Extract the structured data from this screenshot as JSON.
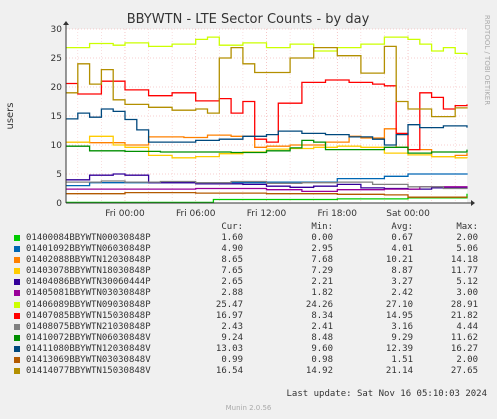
{
  "chart_data": {
    "type": "line",
    "title": "BBYWTN - LTE Sector Counts - by day",
    "ylabel": "users",
    "ylim": [
      0,
      30
    ],
    "y_ticks": [
      0,
      5,
      10,
      15,
      20,
      25,
      30
    ],
    "x_ticks": [
      "Fri 00:00",
      "Fri 06:00",
      "Fri 12:00",
      "Fri 18:00",
      "Sat 00:00"
    ],
    "x_range_hours": [
      -5,
      29
    ],
    "grid": true,
    "side_label": "RRDTOOL / TOBI OETIKER",
    "series": [
      {
        "name": "01400084BBYWTN00030848P",
        "color": "#00cc00",
        "cur": "1.60",
        "min": "0.00",
        "avg": "0.67",
        "max": "2.00",
        "points": [
          [
            -5,
            0.1
          ],
          [
            7,
            0.1
          ],
          [
            7.5,
            0.6
          ],
          [
            12,
            0.6
          ],
          [
            18,
            0.7
          ],
          [
            24,
            0.9
          ],
          [
            29,
            1.6
          ]
        ]
      },
      {
        "name": "01401092BBYWTN06030848P",
        "color": "#0066b3",
        "cur": "4.90",
        "min": "2.95",
        "avg": "4.01",
        "max": "5.06",
        "points": [
          [
            -5,
            3.0
          ],
          [
            -3,
            3.5
          ],
          [
            0,
            3.5
          ],
          [
            6,
            3.5
          ],
          [
            12,
            3.6
          ],
          [
            18,
            4.2
          ],
          [
            22,
            4.6
          ],
          [
            24,
            5.0
          ],
          [
            29,
            4.9
          ]
        ]
      },
      {
        "name": "01402088BBYWTN12030848P",
        "color": "#ff8000",
        "cur": "8.65",
        "min": "7.68",
        "avg": "10.21",
        "max": "14.18",
        "points": [
          [
            -5,
            10.5
          ],
          [
            -3,
            10.4
          ],
          [
            0,
            10
          ],
          [
            2,
            11.4
          ],
          [
            5,
            11.3
          ],
          [
            7,
            11.7
          ],
          [
            9,
            11.5
          ],
          [
            11,
            9.6
          ],
          [
            12,
            9.8
          ],
          [
            14,
            10
          ],
          [
            17,
            10.5
          ],
          [
            19,
            11.5
          ],
          [
            20,
            11.2
          ],
          [
            22,
            12.8
          ],
          [
            23,
            9.6
          ],
          [
            24,
            9.2
          ],
          [
            26,
            8
          ],
          [
            28,
            8.2
          ],
          [
            29,
            8.6
          ]
        ]
      },
      {
        "name": "01403078BBYWTN18030848P",
        "color": "#ffcc00",
        "cur": "7.65",
        "min": "7.29",
        "avg": "8.87",
        "max": "11.77",
        "points": [
          [
            -5,
            10.5
          ],
          [
            -3,
            11.5
          ],
          [
            -1,
            10
          ],
          [
            0,
            9.6
          ],
          [
            2,
            8.2
          ],
          [
            4,
            7.8
          ],
          [
            6,
            8
          ],
          [
            8,
            8.5
          ],
          [
            10,
            8.8
          ],
          [
            12,
            9.3
          ],
          [
            14,
            9.4
          ],
          [
            16,
            9.6
          ],
          [
            18,
            9.8
          ],
          [
            20,
            9.6
          ],
          [
            22,
            8.6
          ],
          [
            24,
            8.3
          ],
          [
            26,
            8.0
          ],
          [
            28,
            7.8
          ],
          [
            29,
            7.7
          ]
        ]
      },
      {
        "name": "01404086BBYWTN30060444P",
        "color": "#330099",
        "cur": "2.65",
        "min": "2.21",
        "avg": "3.27",
        "max": "5.12",
        "points": [
          [
            -5,
            4.0
          ],
          [
            -3,
            4.8
          ],
          [
            -1,
            5.0
          ],
          [
            0,
            4.8
          ],
          [
            2,
            3.5
          ],
          [
            6,
            3.3
          ],
          [
            10,
            3.2
          ],
          [
            12,
            2.9
          ],
          [
            14,
            2.7
          ],
          [
            16,
            2.9
          ],
          [
            18,
            3.2
          ],
          [
            20,
            2.6
          ],
          [
            22,
            2.5
          ],
          [
            24,
            2.4
          ],
          [
            26,
            2.6
          ],
          [
            29,
            2.65
          ]
        ]
      },
      {
        "name": "01405081BBYWTN03030848P",
        "color": "#990099",
        "cur": "2.88",
        "min": "1.82",
        "avg": "2.42",
        "max": "3.00",
        "points": [
          [
            -5,
            2.4
          ],
          [
            0,
            2.4
          ],
          [
            6,
            2.5
          ],
          [
            12,
            2.3
          ],
          [
            15,
            2.0
          ],
          [
            18,
            2.3
          ],
          [
            22,
            2.4
          ],
          [
            25,
            2.8
          ],
          [
            29,
            2.88
          ]
        ]
      },
      {
        "name": "01406089BBYWTN09030848P",
        "color": "#ccff00",
        "cur": "25.47",
        "min": "24.26",
        "avg": "27.10",
        "max": "28.91",
        "points": [
          [
            -5,
            26.8
          ],
          [
            -3,
            27.5
          ],
          [
            -1,
            27.2
          ],
          [
            0,
            27.6
          ],
          [
            2,
            27.0
          ],
          [
            4,
            27.4
          ],
          [
            6,
            28.2
          ],
          [
            7,
            28.6
          ],
          [
            8,
            27.2
          ],
          [
            10,
            27.6
          ],
          [
            12,
            26.8
          ],
          [
            14,
            27.4
          ],
          [
            16,
            26.2
          ],
          [
            18,
            26.8
          ],
          [
            20,
            27.4
          ],
          [
            22,
            28.6
          ],
          [
            24,
            28.2
          ],
          [
            25,
            27.4
          ],
          [
            26,
            26.2
          ],
          [
            27,
            26.8
          ],
          [
            28,
            25.8
          ],
          [
            29,
            25.5
          ]
        ]
      },
      {
        "name": "01407085BBYWTN15030848P",
        "color": "#ff0000",
        "cur": "16.97",
        "min": "8.34",
        "avg": "14.95",
        "max": "21.82",
        "points": [
          [
            -5,
            20.6
          ],
          [
            -4,
            18.8
          ],
          [
            -2,
            21.0
          ],
          [
            0,
            19.5
          ],
          [
            2,
            18.5
          ],
          [
            4,
            19.0
          ],
          [
            6,
            17.6
          ],
          [
            8,
            18.0
          ],
          [
            9,
            15.5
          ],
          [
            10,
            17.5
          ],
          [
            11,
            11
          ],
          [
            12,
            10.5
          ],
          [
            13,
            17.2
          ],
          [
            15,
            20.8
          ],
          [
            17,
            21.2
          ],
          [
            19,
            20.8
          ],
          [
            21,
            20.5
          ],
          [
            22,
            20.2
          ],
          [
            23,
            12
          ],
          [
            24,
            9.2
          ],
          [
            25,
            19.0
          ],
          [
            26,
            18.2
          ],
          [
            27,
            16.2
          ],
          [
            28,
            16.8
          ],
          [
            29,
            17.0
          ]
        ]
      },
      {
        "name": "01408075BBYWTN21030848P",
        "color": "#808080",
        "cur": "2.43",
        "min": "2.41",
        "avg": "3.16",
        "max": "4.44",
        "points": [
          [
            -5,
            3.6
          ],
          [
            -2,
            3.8
          ],
          [
            0,
            3.6
          ],
          [
            3,
            3.7
          ],
          [
            6,
            3.5
          ],
          [
            9,
            3.7
          ],
          [
            12,
            3.4
          ],
          [
            15,
            3.5
          ],
          [
            18,
            3.6
          ],
          [
            21,
            3.2
          ],
          [
            24,
            2.8
          ],
          [
            27,
            2.5
          ],
          [
            29,
            2.43
          ]
        ]
      },
      {
        "name": "01410072BBYWTN06030848V",
        "color": "#008f00",
        "cur": "9.24",
        "min": "8.48",
        "avg": "9.29",
        "max": "11.62",
        "points": [
          [
            -5,
            9.8
          ],
          [
            -3,
            9.0
          ],
          [
            0,
            8.9
          ],
          [
            3,
            8.8
          ],
          [
            6,
            8.8
          ],
          [
            9,
            8.7
          ],
          [
            12,
            9.0
          ],
          [
            14,
            9.5
          ],
          [
            15,
            10.8
          ],
          [
            16,
            10.5
          ],
          [
            17,
            9.2
          ],
          [
            20,
            9.2
          ],
          [
            22,
            9.6
          ],
          [
            24,
            8.6
          ],
          [
            26,
            8.8
          ],
          [
            29,
            9.2
          ]
        ]
      },
      {
        "name": "01411080BBYWTN12030848V",
        "color": "#00487d",
        "cur": "13.03",
        "min": "9.60",
        "avg": "12.39",
        "max": "16.27",
        "points": [
          [
            -5,
            14.5
          ],
          [
            -4,
            15.5
          ],
          [
            -3,
            14.8
          ],
          [
            -2,
            16.2
          ],
          [
            -1,
            15.8
          ],
          [
            0,
            14.4
          ],
          [
            1,
            12.6
          ],
          [
            2,
            10.5
          ],
          [
            4,
            10.5
          ],
          [
            6,
            10.8
          ],
          [
            8,
            11.0
          ],
          [
            10,
            11.5
          ],
          [
            12,
            11.8
          ],
          [
            13,
            12.4
          ],
          [
            15,
            12.0
          ],
          [
            17,
            11.8
          ],
          [
            19,
            11.4
          ],
          [
            21,
            11.0
          ],
          [
            22,
            10.0
          ],
          [
            23,
            11.8
          ],
          [
            24,
            13.5
          ],
          [
            25,
            13.0
          ],
          [
            27,
            13.3
          ],
          [
            29,
            13.0
          ]
        ]
      },
      {
        "name": "01413069BBYWTN03030848V",
        "color": "#b35a00",
        "cur": "0.99",
        "min": "0.98",
        "avg": "1.51",
        "max": "2.00",
        "points": [
          [
            -5,
            1.6
          ],
          [
            0,
            1.8
          ],
          [
            6,
            1.7
          ],
          [
            12,
            1.6
          ],
          [
            18,
            1.5
          ],
          [
            22,
            1.4
          ],
          [
            24,
            1.0
          ],
          [
            29,
            0.99
          ]
        ]
      },
      {
        "name": "01414077BBYWTN15030848V",
        "color": "#b38f00",
        "cur": "16.54",
        "min": "14.92",
        "avg": "21.14",
        "max": "27.65",
        "points": [
          [
            -5,
            19.0
          ],
          [
            -4,
            24.0
          ],
          [
            -3,
            20.5
          ],
          [
            -2,
            23.0
          ],
          [
            -1,
            17.8
          ],
          [
            0,
            17.0
          ],
          [
            2,
            16.5
          ],
          [
            4,
            16.0
          ],
          [
            6,
            16.2
          ],
          [
            7,
            15.5
          ],
          [
            8,
            25.0
          ],
          [
            9,
            26.8
          ],
          [
            10,
            24.0
          ],
          [
            11,
            22.5
          ],
          [
            12,
            22.5
          ],
          [
            14,
            25.0
          ],
          [
            16,
            26.8
          ],
          [
            18,
            25.4
          ],
          [
            20,
            22.4
          ],
          [
            22,
            27.0
          ],
          [
            23,
            17.5
          ],
          [
            24,
            16.2
          ],
          [
            26,
            14.9
          ],
          [
            28,
            16.4
          ],
          [
            29,
            16.5
          ]
        ]
      }
    ]
  },
  "legend_header": {
    "cur": "Cur:",
    "min": "Min:",
    "avg": "Avg:",
    "max": "Max:"
  },
  "last_update": "Last update: Sat Nov 16 05:10:03 2024",
  "footer": "Munin 2.0.56"
}
